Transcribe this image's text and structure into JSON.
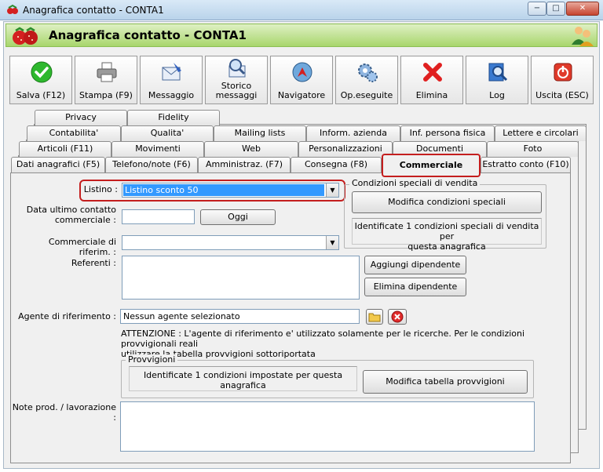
{
  "window": {
    "title": "Anagrafica contatto - CONTA1",
    "min": "−",
    "max": "□",
    "close": "✕"
  },
  "header": {
    "title": "Anagrafica contatto - CONTA1"
  },
  "toolbar": {
    "buttons": [
      {
        "label": "Salva (F12)",
        "icon": "check-icon"
      },
      {
        "label": "Stampa (F9)",
        "icon": "printer-icon"
      },
      {
        "label": "Messaggio",
        "icon": "mail-icon"
      },
      {
        "label": "Storico\nmessaggi",
        "icon": "mail-search-icon"
      },
      {
        "label": "Navigatore",
        "icon": "navigator-icon"
      },
      {
        "label": "Op.eseguite",
        "icon": "gears-icon"
      },
      {
        "label": "Elimina",
        "icon": "delete-icon"
      },
      {
        "label": "Log",
        "icon": "log-icon"
      },
      {
        "label": "Uscita (ESC)",
        "icon": "exit-icon"
      }
    ]
  },
  "tabs": {
    "row1": [
      "Privacy",
      "Fidelity"
    ],
    "row2": [
      "Contabilita'",
      "Qualita'",
      "Mailing lists",
      "Inform. azienda",
      "Inf. persona fisica",
      "Lettere e circolari"
    ],
    "row3": [
      "Articoli (F11)",
      "Movimenti",
      "Web",
      "Personalizzazioni",
      "Documenti",
      "Foto"
    ],
    "row4": [
      "Dati anagrafici (F5)",
      "Telefono/note (F6)",
      "Amministraz. (F7)",
      "Consegna (F8)",
      "Commerciale",
      "Estratto conto (F10)"
    ]
  },
  "form": {
    "listino_label": "Listino :",
    "listino_value": "Listino sconto 50",
    "data_contatto_label_1": "Data ultimo contatto",
    "data_contatto_label_2": "commerciale :",
    "data_contatto_value": "",
    "oggi_button": "Oggi",
    "commerciale_label": "Commerciale di riferim. :",
    "commerciale_value": "",
    "referenti_label": "Referenti :",
    "aggiungi_button": "Aggiungi dipendente",
    "elimina_button": "Elimina dipendente",
    "agente_label": "Agente di riferimento :",
    "agente_value": "Nessun agente selezionato",
    "attenzione_line1": "ATTENZIONE : L'agente di riferimento e' utilizzato solamente per le ricerche. Per le condizioni provvigionali reali",
    "attenzione_line2": "utilizzare la tabella provvigioni sottoriportata",
    "note_label": "Note prod. / lavorazione :",
    "note_value": ""
  },
  "condizioni": {
    "title": "Condizioni speciali di vendita",
    "modifica_button": "Modifica condizioni speciali",
    "info_line1": "Identificate 1 condizioni speciali di vendita per",
    "info_line2": "questa anagrafica"
  },
  "provvigioni": {
    "title": "Provvigioni",
    "info": "Identificate 1 condizioni impostate per questa anagrafica",
    "modifica_button": "Modifica tabella provvigioni"
  },
  "colors": {
    "highlight": "#c41e1e",
    "selection": "#3399ff",
    "header_green": "#a8d66c"
  }
}
